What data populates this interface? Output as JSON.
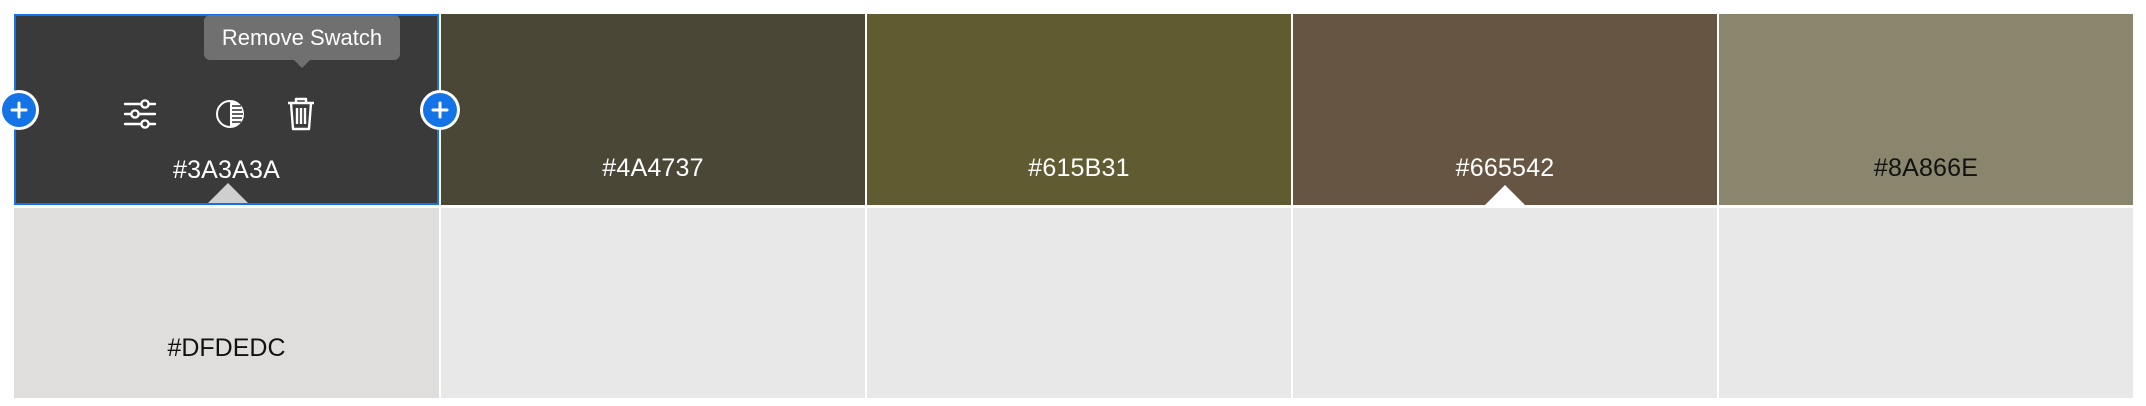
{
  "swatches": [
    {
      "hex": "#3A3A3A",
      "color": "#3A3A3A",
      "text_color": "light",
      "selected": true
    },
    {
      "hex": "#4A4737",
      "color": "#4A4737",
      "text_color": "light",
      "selected": false
    },
    {
      "hex": "#615B31",
      "color": "#615B31",
      "text_color": "light",
      "selected": false
    },
    {
      "hex": "#665542",
      "color": "#665542",
      "text_color": "light",
      "selected": false
    },
    {
      "hex": "#8A866E",
      "color": "#8A866E",
      "text_color": "dark",
      "selected": false
    }
  ],
  "shades": [
    {
      "hex": "#DFDEDC",
      "color": "#DFDEDC"
    },
    {
      "hex": "",
      "color": "#E8E8E8"
    },
    {
      "hex": "",
      "color": "#E8E8E8"
    },
    {
      "hex": "",
      "color": "#E8E8E8"
    },
    {
      "hex": "",
      "color": "#E8E8E8"
    }
  ],
  "tooltip": {
    "text": "Remove Swatch"
  },
  "actions": {
    "adjust_icon": "sliders-icon",
    "contrast_icon": "contrast-icon",
    "delete_icon": "trash-icon",
    "add_icon": "plus-icon"
  },
  "accent_color": "#1473E6"
}
